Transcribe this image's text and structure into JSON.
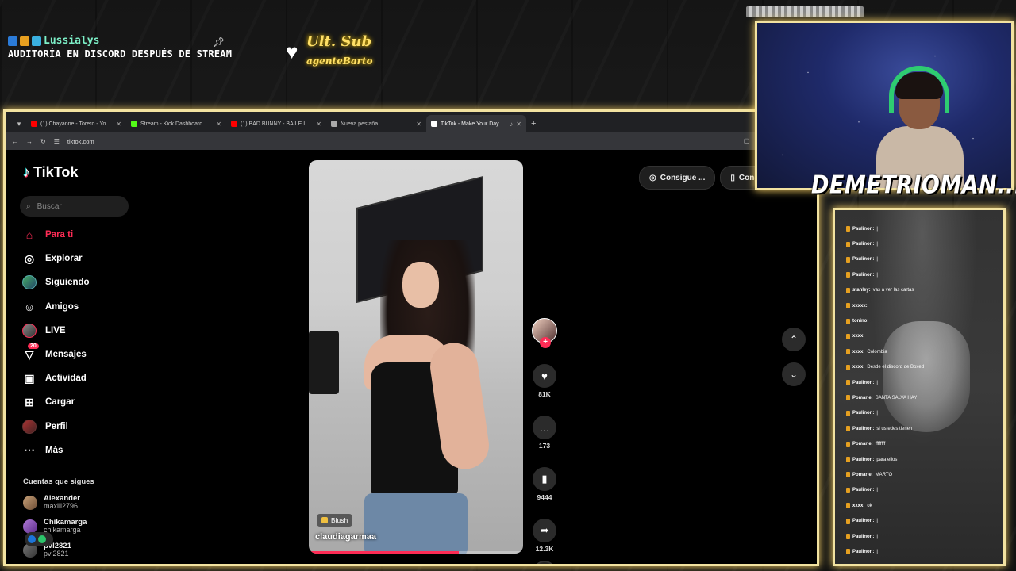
{
  "overlay": {
    "username": "Lussialys",
    "message": "AUDITORÍA EN DISCORD DESPUÉS DE STREAM",
    "ult_sub_label": "Ult. Sub",
    "ult_sub_name": "agenteBarto"
  },
  "browser": {
    "tabs": [
      {
        "title": "(1) Chayanne - Torero - YouTube",
        "favicon_color": "#ff0000",
        "active": false
      },
      {
        "title": "Stream - Kick Dashboard",
        "favicon_color": "#53fc18",
        "active": false
      },
      {
        "title": "(1) BAD BUNNY - BAILE INoLVID",
        "favicon_color": "#ff0000",
        "active": false
      },
      {
        "title": "Nueva pestaña",
        "favicon_color": "#aaaaaa",
        "active": false
      },
      {
        "title": "TikTok - Make Your Day",
        "favicon_color": "#ffffff",
        "active": true
      }
    ],
    "url": "tiktok.com"
  },
  "tiktok": {
    "brand": "TikTok",
    "search_placeholder": "Buscar",
    "nav": [
      {
        "label": "Para ti",
        "icon": "home-icon",
        "active": true
      },
      {
        "label": "Explorar",
        "icon": "compass-icon"
      },
      {
        "label": "Siguiendo",
        "icon": "following-avatar-icon"
      },
      {
        "label": "Amigos",
        "icon": "friends-icon"
      },
      {
        "label": "LIVE",
        "icon": "live-icon"
      },
      {
        "label": "Mensajes",
        "icon": "messages-icon",
        "badge": "20"
      },
      {
        "label": "Actividad",
        "icon": "activity-icon"
      },
      {
        "label": "Cargar",
        "icon": "upload-icon"
      },
      {
        "label": "Perfil",
        "icon": "profile-icon"
      },
      {
        "label": "Más",
        "icon": "more-icon"
      }
    ],
    "following_title": "Cuentas que sigues",
    "following": [
      {
        "name": "Alexander",
        "handle": "maxiii2796"
      },
      {
        "name": "Chikamarga",
        "handle": "chikamarga"
      },
      {
        "name": "pvl2821",
        "handle": "pvl2821"
      }
    ],
    "video": {
      "tag": "Blush",
      "author": "claudiagarmaa",
      "progress": 0.7
    },
    "actions": {
      "likes": "81K",
      "comments": "173",
      "saves": "9444",
      "shares": "12.3K"
    },
    "top_buttons": [
      "Consigue ...",
      "Consegui"
    ]
  },
  "webcam": {
    "streamer_name": "DEMETRIOMAN..."
  },
  "chat": {
    "messages": [
      {
        "user": "Paulinon:",
        "text": "|"
      },
      {
        "user": "Paulinon:",
        "text": "|"
      },
      {
        "user": "Paulinon:",
        "text": "|"
      },
      {
        "user": "Paulinon:",
        "text": "|"
      },
      {
        "user": "stanley:",
        "text": "vas a ver las cartas"
      },
      {
        "user": "xxxxx:",
        "text": ""
      },
      {
        "user": "tonino:",
        "text": ""
      },
      {
        "user": "xxxx:",
        "text": ""
      },
      {
        "user": "xxxx:",
        "text": "Colombia"
      },
      {
        "user": "xxxx:",
        "text": "Desde el discord de Boxed"
      },
      {
        "user": "Paulinon:",
        "text": "|"
      },
      {
        "user": "Pomarie:",
        "text": "SANTA SALVA HAY"
      },
      {
        "user": "Paulinon:",
        "text": "|"
      },
      {
        "user": "Paulinon:",
        "text": "si ustedes tienen"
      },
      {
        "user": "Pomarie:",
        "text": "ffffffff"
      },
      {
        "user": "Paulinon:",
        "text": "para ellos"
      },
      {
        "user": "Pomarie:",
        "text": "MARTO"
      },
      {
        "user": "Paulinon:",
        "text": "|"
      },
      {
        "user": "xxxx:",
        "text": "ok"
      },
      {
        "user": "Paulinon:",
        "text": "|"
      },
      {
        "user": "Paulinon:",
        "text": "|"
      },
      {
        "user": "Paulinon:",
        "text": "|"
      }
    ]
  }
}
